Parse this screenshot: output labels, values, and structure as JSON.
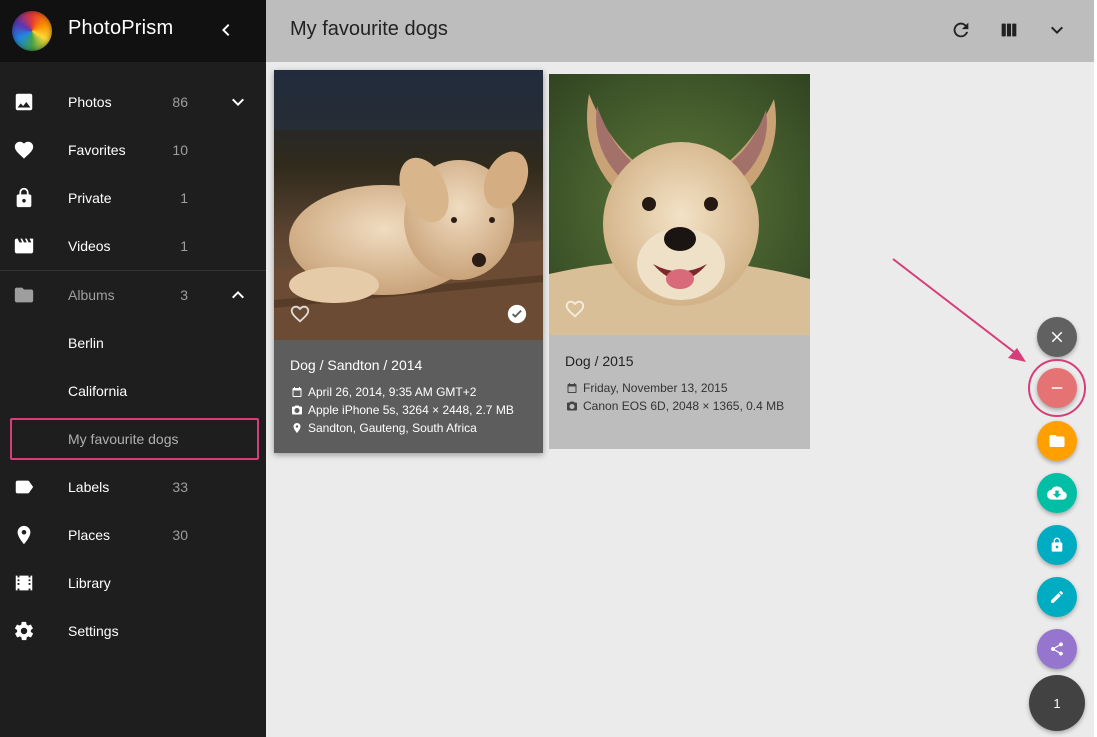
{
  "app": {
    "name": "PhotoPrism"
  },
  "toolbar": {
    "title": "My favourite dogs"
  },
  "sidebar": {
    "items": [
      {
        "label": "Photos",
        "count": "86"
      },
      {
        "label": "Favorites",
        "count": "10"
      },
      {
        "label": "Private",
        "count": "1"
      },
      {
        "label": "Videos",
        "count": "1"
      },
      {
        "label": "Albums",
        "count": "3"
      },
      {
        "label": "Berlin"
      },
      {
        "label": "California"
      },
      {
        "label": "My favourite dogs"
      },
      {
        "label": "Labels",
        "count": "33"
      },
      {
        "label": "Places",
        "count": "30"
      },
      {
        "label": "Library"
      },
      {
        "label": "Settings"
      }
    ]
  },
  "photos": [
    {
      "title": "Dog / Sandton / 2014",
      "date": "April 26, 2014, 9:35 AM GMT+2",
      "camera": "Apple iPhone 5s, 3264 × 2448, 2.7 MB",
      "location": "Sandton, Gauteng, South Africa",
      "selected": true
    },
    {
      "title": "Dog / 2015",
      "date": "Friday, November 13, 2015",
      "camera": "Canon EOS 6D, 2048 × 1365, 0.4 MB",
      "selected": false
    }
  ],
  "fab": {
    "selection_count": "1"
  },
  "colors": {
    "accent": "#d63d79",
    "fab_close": "#616161",
    "fab_remove": "#e57373",
    "fab_album": "#ffa000",
    "fab_download": "#00bfa5",
    "fab_private": "#00acc1",
    "fab_edit": "#00acc1",
    "fab_share": "#9575cd",
    "fab_count": "#424242"
  }
}
